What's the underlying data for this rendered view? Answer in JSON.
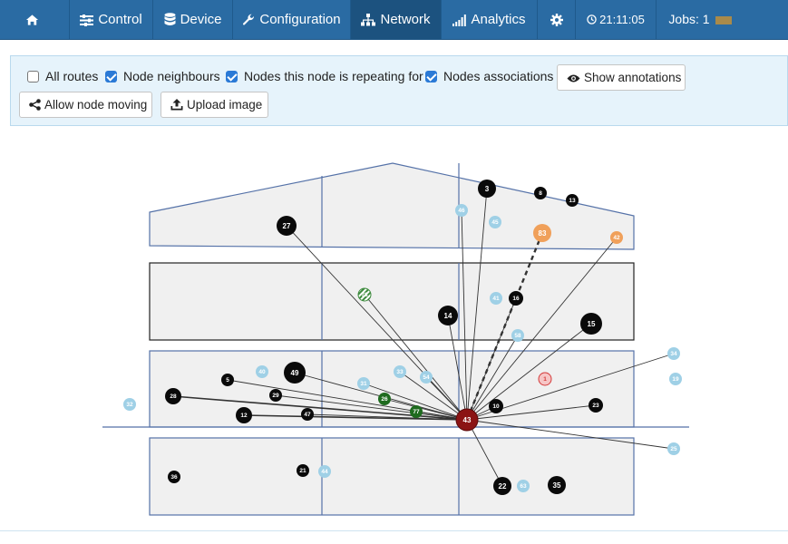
{
  "nav": {
    "control": "Control",
    "device": "Device",
    "configuration": "Configuration",
    "network": "Network",
    "analytics": "Analytics",
    "time": "21:11:05",
    "jobs": "Jobs: 1"
  },
  "options": {
    "all_routes": {
      "label": "All routes",
      "checked": false
    },
    "node_neighbours": {
      "label": "Node neighbours",
      "checked": true
    },
    "repeating": {
      "label": "Nodes this node is repeating for",
      "checked": true
    },
    "associations": {
      "label": "Nodes associations",
      "checked": true
    },
    "show_annotations": "Show annotations",
    "allow_moving": "Allow node moving",
    "upload_image": "Upload image"
  },
  "colors": {
    "navbar": "#2a6ba3",
    "selected_node": "#8b1414",
    "node_black": "#0a0a0a",
    "node_light": "#9fd0e6",
    "node_orange": "#f0a05a",
    "node_green": "#1f6b1f",
    "wall": "#5572a8",
    "room_fill": "#f0f0f0"
  },
  "map": {
    "selected": "43",
    "nodes": [
      {
        "id": "3",
        "type": "black"
      },
      {
        "id": "8",
        "type": "black"
      },
      {
        "id": "13",
        "type": "black"
      },
      {
        "id": "27",
        "type": "black"
      },
      {
        "id": "46",
        "type": "light"
      },
      {
        "id": "45",
        "type": "light"
      },
      {
        "id": "83",
        "type": "orange"
      },
      {
        "id": "42",
        "type": "orange"
      },
      {
        "id": "78",
        "type": "green-hatched"
      },
      {
        "id": "41",
        "type": "light"
      },
      {
        "id": "16",
        "type": "black"
      },
      {
        "id": "14",
        "type": "black"
      },
      {
        "id": "15",
        "type": "black"
      },
      {
        "id": "58",
        "type": "light"
      },
      {
        "id": "34",
        "type": "light"
      },
      {
        "id": "19",
        "type": "light"
      },
      {
        "id": "5",
        "type": "black"
      },
      {
        "id": "40",
        "type": "light"
      },
      {
        "id": "49",
        "type": "black"
      },
      {
        "id": "33",
        "type": "light"
      },
      {
        "id": "54",
        "type": "light"
      },
      {
        "id": "31",
        "type": "light"
      },
      {
        "id": "1",
        "type": "failed"
      },
      {
        "id": "32",
        "type": "light"
      },
      {
        "id": "28",
        "type": "black"
      },
      {
        "id": "29",
        "type": "black"
      },
      {
        "id": "26",
        "type": "green"
      },
      {
        "id": "10",
        "type": "black"
      },
      {
        "id": "23",
        "type": "black"
      },
      {
        "id": "12",
        "type": "black"
      },
      {
        "id": "47",
        "type": "black"
      },
      {
        "id": "77",
        "type": "green"
      },
      {
        "id": "43",
        "type": "selected"
      },
      {
        "id": "25",
        "type": "light"
      },
      {
        "id": "36",
        "type": "black"
      },
      {
        "id": "21",
        "type": "black"
      },
      {
        "id": "44",
        "type": "light"
      },
      {
        "id": "22",
        "type": "black"
      },
      {
        "id": "63",
        "type": "light"
      },
      {
        "id": "35",
        "type": "black"
      }
    ]
  }
}
